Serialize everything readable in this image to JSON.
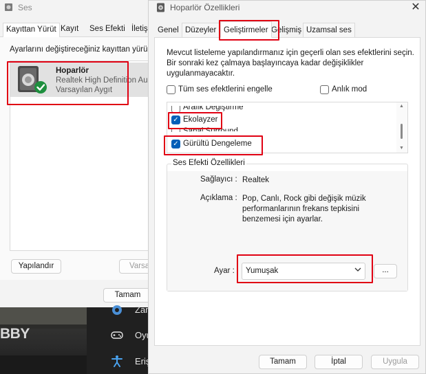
{
  "ses": {
    "title": "Ses",
    "tabs": [
      "Kayıttan Yürüt",
      "Kayıt",
      "Ses Efekti",
      "İletişi"
    ],
    "instruction": "Ayarlarını değiştireceğiniz kayıttan yürü",
    "device": {
      "name": "Hoparlör",
      "description": "Realtek High Definition Au",
      "default_label": "Varsayılan Aygıt"
    },
    "configure_button": "Yapılandır",
    "set_default_button": "Varsa",
    "ok_button": "Tamam"
  },
  "background_app": {
    "photo_text": "BBY",
    "menu_items": [
      "Zam",
      "Oyu",
      "Eriş"
    ]
  },
  "hoparlor": {
    "title": "Hoparlör Özellikleri",
    "close_glyph": "✕",
    "tabs": [
      "Genel",
      "Düzeyler",
      "Geliştirmeler",
      "Gelişmiş",
      "Uzamsal ses"
    ],
    "active_tab": "Geliştirmeler",
    "description": "Mevcut listeleme yapılandırmanız için geçerli olan ses efektlerini seçin. Bir sonraki kez çalmaya başlayıncaya kadar değişiklikler uygulanmayacaktır.",
    "disable_all_label": "Tüm ses efektlerini engelle",
    "disable_all_checked": false,
    "instant_mode_label": "Anlık mod",
    "instant_mode_checked": false,
    "effects": [
      {
        "label": "Aralık Değiştirme",
        "checked": false
      },
      {
        "label": "Ekolayzer",
        "checked": true
      },
      {
        "label": "Sanal Surround",
        "checked": false
      },
      {
        "label": "Gürültü Dengeleme",
        "checked": true
      }
    ],
    "properties_title": "Ses Efekti Özellikleri",
    "provider_key": "Sağlayıcı :",
    "provider_value": "Realtek",
    "description_key": "Açıklama :",
    "description_value": "Pop, Canlı, Rock gibi değişik müzik performanlarının frekans tepkisini benzemesi için ayarlar.",
    "setting_key": "Ayar :",
    "setting_value": "Yumuşak",
    "more_button": "...",
    "ok_button": "Tamam",
    "cancel_button": "İptal",
    "apply_button": "Uygula"
  },
  "colors": {
    "highlight": "#e00012",
    "accent": "#005fb8",
    "window_bg": "#f3f3f3"
  }
}
